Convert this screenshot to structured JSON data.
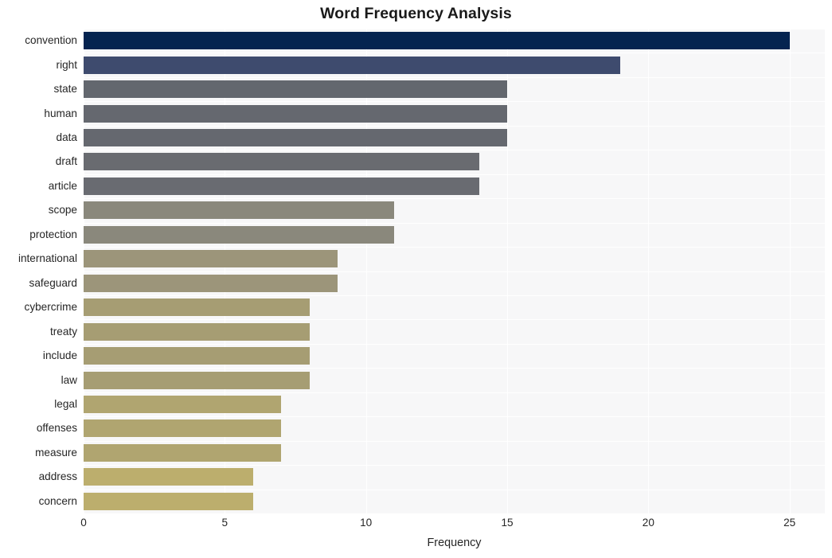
{
  "chart_data": {
    "type": "bar",
    "orientation": "horizontal",
    "title": "Word Frequency Analysis",
    "xlabel": "Frequency",
    "ylabel": "",
    "xlim": [
      0,
      26.25
    ],
    "xticks": [
      0,
      5,
      10,
      15,
      20,
      25
    ],
    "xtick_labels": [
      "0",
      "5",
      "10",
      "15",
      "20",
      "25"
    ],
    "grid": true,
    "legend": null,
    "categories": [
      "convention",
      "right",
      "state",
      "human",
      "data",
      "draft",
      "article",
      "scope",
      "protection",
      "international",
      "safeguard",
      "cybercrime",
      "treaty",
      "include",
      "law",
      "legal",
      "offenses",
      "measure",
      "address",
      "concern"
    ],
    "values": [
      25,
      19,
      15,
      15,
      15,
      14,
      14,
      11,
      11,
      9,
      9,
      8,
      8,
      8,
      8,
      7,
      7,
      7,
      6,
      6
    ],
    "bar_colors": [
      "#052450",
      "#3e4b6e",
      "#63676e",
      "#65686f",
      "#65686f",
      "#696b70",
      "#696b71",
      "#8a887c",
      "#8a887c",
      "#9c957a",
      "#9c957a",
      "#a69d73",
      "#a69d73",
      "#a69d73",
      "#a69d73",
      "#b0a570",
      "#b0a570",
      "#b0a570",
      "#bcae6d",
      "#bcae6d"
    ],
    "plot_background": "#f7f7f8",
    "gridline_color": "#ffffff",
    "figure_background": "#ffffff",
    "text_color": "#262626"
  }
}
